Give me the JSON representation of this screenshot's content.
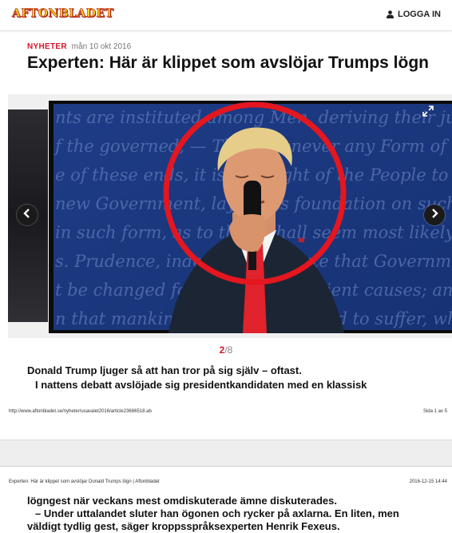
{
  "header": {
    "logo_text": "AFTONBLADET",
    "login_label": "LOGGA IN",
    "brand_color": "#f7d515",
    "accent": "#d7142b"
  },
  "article": {
    "section": "NYHETER",
    "date": "mån 10 okt 2016",
    "headline": "Experten: Här är klippet som avslöjar Trumps lögn"
  },
  "gallery": {
    "current": "2",
    "separator": "/",
    "total": "8",
    "prev_icon": "chevron-left-icon",
    "next_icon": "chevron-right-icon",
    "expand_icon": "expand-icon",
    "caption_line1": "Donald Trump ljuger så att han tror på sig själv – oftast.",
    "caption_line2": "I nattens debatt avslöjade sig presidentkandidaten med en klassisk",
    "background_lines": [
      "nts are instituted among Men, deriving their ju",
      "f the governed, — That whenever any Form of G",
      "e of these ends, it is the Right of the People to alter o",
      "new Government, laying its foundation on such princ",
      "in such form, as to them shall seem most likely to",
      "s. Prudence, indeed, will dictate that Governmen",
      "t be changed for light and transient causes; and accor",
      "n that mankind are more disposed to suffer, while evils"
    ]
  },
  "print": {
    "url": "http://www.aftonbladet.se/nyheter/usavalet2016/article23686518.ab",
    "page_label": "Sida 1 av 5",
    "doc_title": "Experten: Här är klippet som avslöjar Donald Trumps lögn | Aftonbladet",
    "timestamp": "2016-12-15 14:44"
  },
  "body": {
    "line1": "lögngest när veckans mest omdiskuterade ämne diskuterades.",
    "line2": "– Under uttalandet sluter han ögonen och rycker på axlarna. En liten, men",
    "line3": "väldigt tydlig gest, säger kroppsspråksexperten Henrik Fexeus."
  }
}
